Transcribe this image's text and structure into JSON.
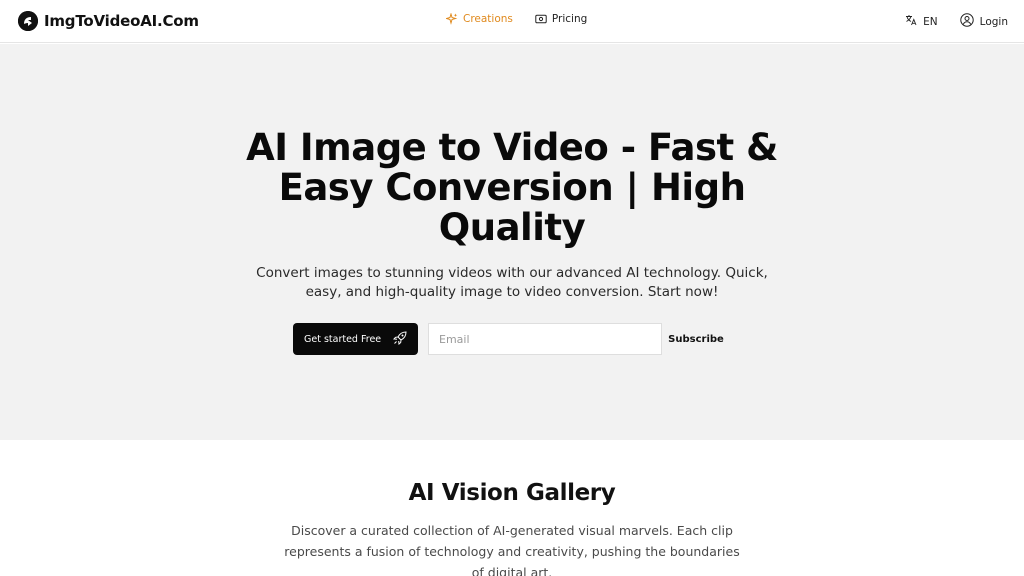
{
  "header": {
    "logo_text": "ImgToVideoAI.Com",
    "nav": [
      {
        "label": "Creations",
        "icon": "sparkles-icon",
        "active": true
      },
      {
        "label": "Pricing",
        "icon": "ticket-icon",
        "active": false
      }
    ],
    "language_label": "EN",
    "login_label": "Login"
  },
  "hero": {
    "title": "AI Image to Video - Fast & Easy Conversion | High Quality",
    "subtitle": "Convert images to stunning videos with our advanced AI technology. Quick, easy, and high-quality image to video conversion. Start now!",
    "cta_label": "Get started Free",
    "email_placeholder": "Email",
    "subscribe_label": "Subscribe"
  },
  "gallery": {
    "title": "AI Vision Gallery",
    "subtitle": "Discover a curated collection of AI-generated visual marvels. Each clip represents a fusion of technology and creativity, pushing the boundaries of digital art."
  },
  "colors": {
    "accent": "#e08a1e",
    "hero_bg": "#f2f2f2",
    "cta_bg": "#0a0a0a"
  }
}
